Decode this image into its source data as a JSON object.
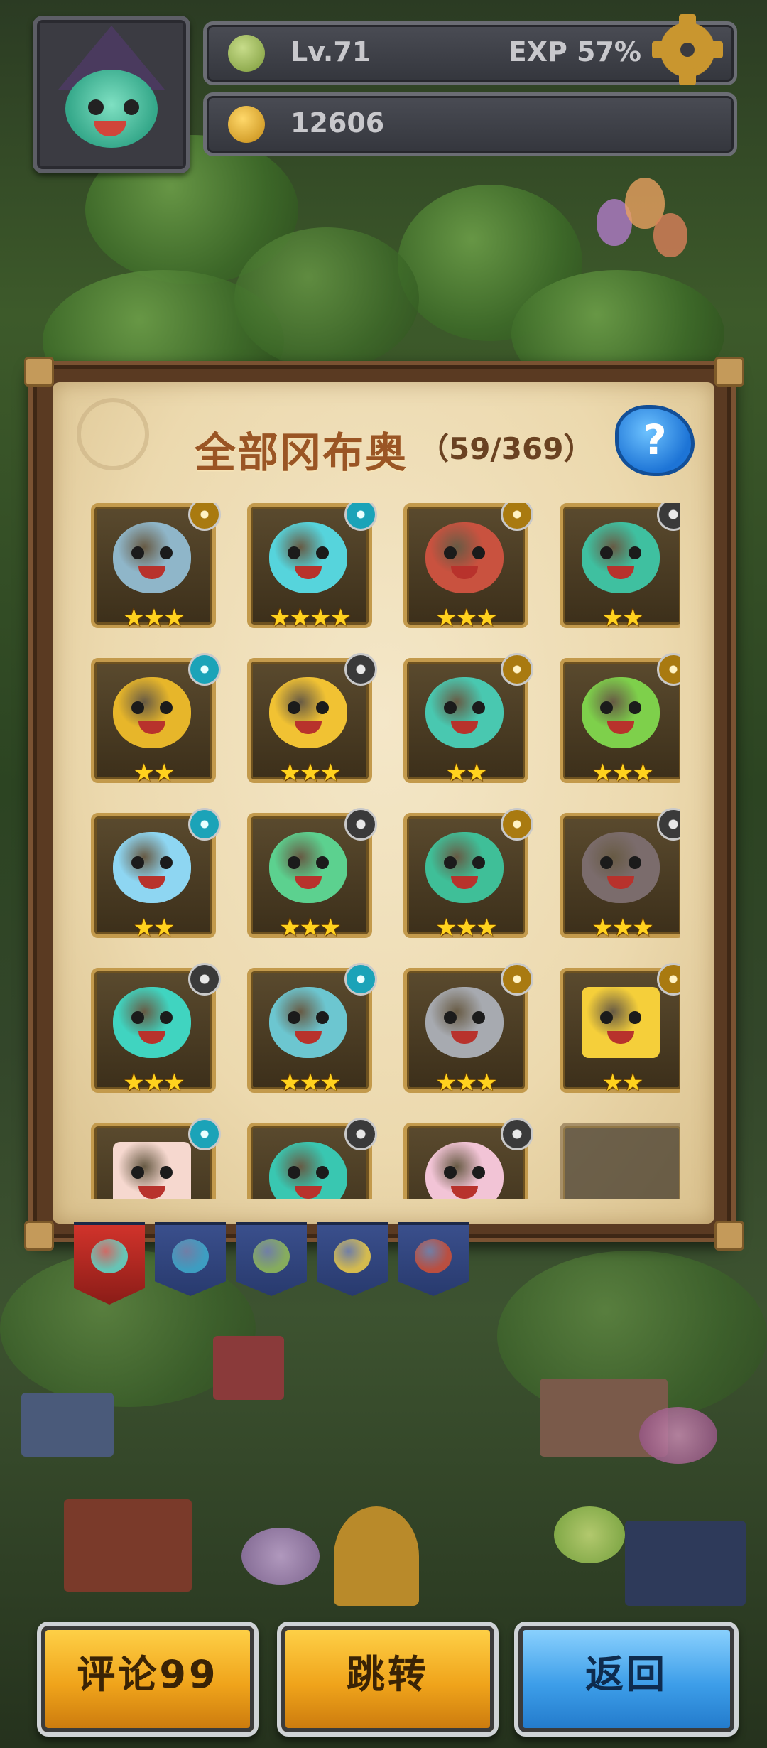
{
  "hud": {
    "level": "Lv.71",
    "exp": "EXP 57%",
    "coins": "12606",
    "level_icon": "leaf-icon",
    "coin_icon": "fruit-coin-icon",
    "settings_icon": "gear-icon"
  },
  "panel": {
    "title": "全部冈布奥",
    "count": "（59/369）",
    "help_label": "?"
  },
  "grid": [
    {
      "color": "#8fb6c9",
      "badge": "gold",
      "stars": "★★★"
    },
    {
      "color": "#56d4dc",
      "badge": "cyan",
      "stars": "★★★★"
    },
    {
      "color": "#c9523f",
      "badge": "gold",
      "stars": "★★★"
    },
    {
      "color": "#3fc0a0",
      "badge": "dark",
      "stars": "★★"
    },
    {
      "color": "#e7b62a",
      "badge": "cyan",
      "stars": "★★"
    },
    {
      "color": "#f1c233",
      "badge": "dark",
      "stars": "★★★"
    },
    {
      "color": "#49c8b0",
      "badge": "gold",
      "stars": "★★"
    },
    {
      "color": "#7ed04b",
      "badge": "gold",
      "stars": "★★★"
    },
    {
      "color": "#8ed6f2",
      "badge": "cyan",
      "stars": "★★"
    },
    {
      "color": "#5cd18f",
      "badge": "dark",
      "stars": "★★★"
    },
    {
      "color": "#3fbf98",
      "badge": "gold",
      "stars": "★★★"
    },
    {
      "color": "#7b6c6c",
      "badge": "dark",
      "stars": "★★★"
    },
    {
      "color": "#40d4c0",
      "badge": "dark",
      "stars": "★★★"
    },
    {
      "color": "#6cc6d0",
      "badge": "cyan",
      "stars": "★★★"
    },
    {
      "color": "#a7aab0",
      "badge": "gold",
      "stars": "★★★"
    },
    {
      "color": "#f5cf3a",
      "badge": "gold",
      "stars": "★★"
    },
    {
      "color": "#f6d8cf",
      "badge": "cyan",
      "stars": ""
    },
    {
      "color": "#39c7b1",
      "badge": "dark",
      "stars": ""
    },
    {
      "color": "#f2c4d6",
      "badge": "dark",
      "stars": ""
    },
    {
      "color": "#3a3125",
      "badge": "none",
      "stars": "",
      "locked": true
    }
  ],
  "tabs": [
    {
      "name": "tab-all",
      "active": true
    },
    {
      "name": "tab-blue",
      "active": false
    },
    {
      "name": "tab-green",
      "active": false
    },
    {
      "name": "tab-yellow",
      "active": false
    },
    {
      "name": "tab-red",
      "active": false
    }
  ],
  "buttons": {
    "comments": "评论99",
    "jump": "跳转",
    "back": "返回"
  }
}
